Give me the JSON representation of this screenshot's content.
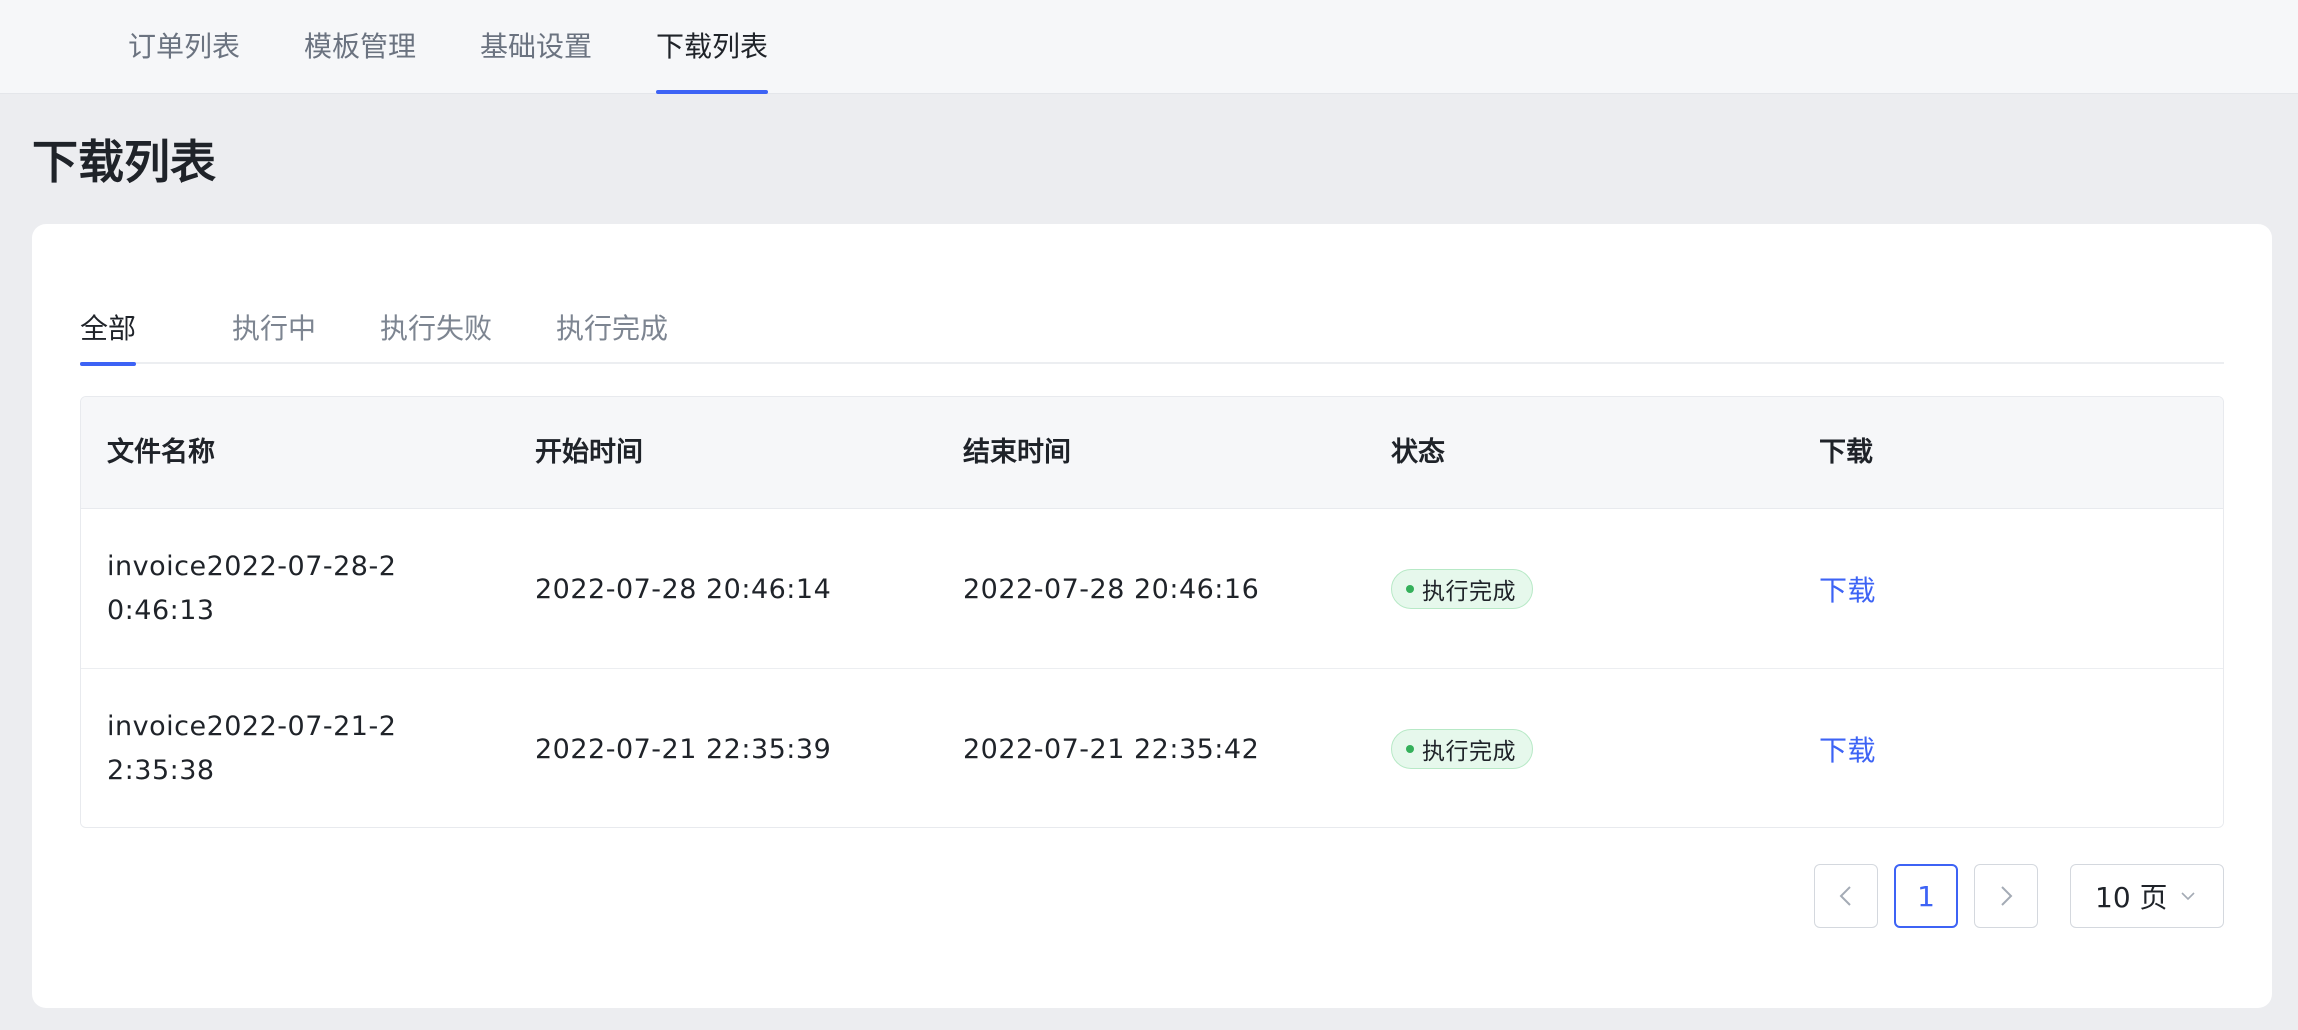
{
  "topnav": {
    "tabs": [
      {
        "label": "订单列表"
      },
      {
        "label": "模板管理"
      },
      {
        "label": "基础设置"
      },
      {
        "label": "下载列表"
      }
    ],
    "active": "下载列表"
  },
  "page": {
    "title": "下载列表"
  },
  "subtabs": [
    {
      "label": "全部"
    },
    {
      "label": "执行中"
    },
    {
      "label": "执行失败"
    },
    {
      "label": "执行完成"
    }
  ],
  "table": {
    "headers": [
      "文件名称",
      "开始时间",
      "结束时间",
      "状态",
      "下载"
    ],
    "rows": [
      {
        "file_name": "invoice2022-07-28-20:46:13",
        "start_time": "2022-07-28 20:46:14",
        "end_time": "2022-07-28 20:46:16",
        "status": "执行完成",
        "action": "下载"
      },
      {
        "file_name": "invoice2022-07-21-22:35:38",
        "start_time": "2022-07-21 22:35:39",
        "end_time": "2022-07-21 22:35:42",
        "status": "执行完成",
        "action": "下载"
      }
    ]
  },
  "pagination": {
    "current_page": "1",
    "page_size": "10 页",
    "prev_icon": "chevron-left-icon",
    "next_icon": "chevron-right-icon"
  },
  "colors": {
    "accent": "#3d63f5",
    "success_bg": "#e6f8ec",
    "success_dot": "#34b05a"
  }
}
